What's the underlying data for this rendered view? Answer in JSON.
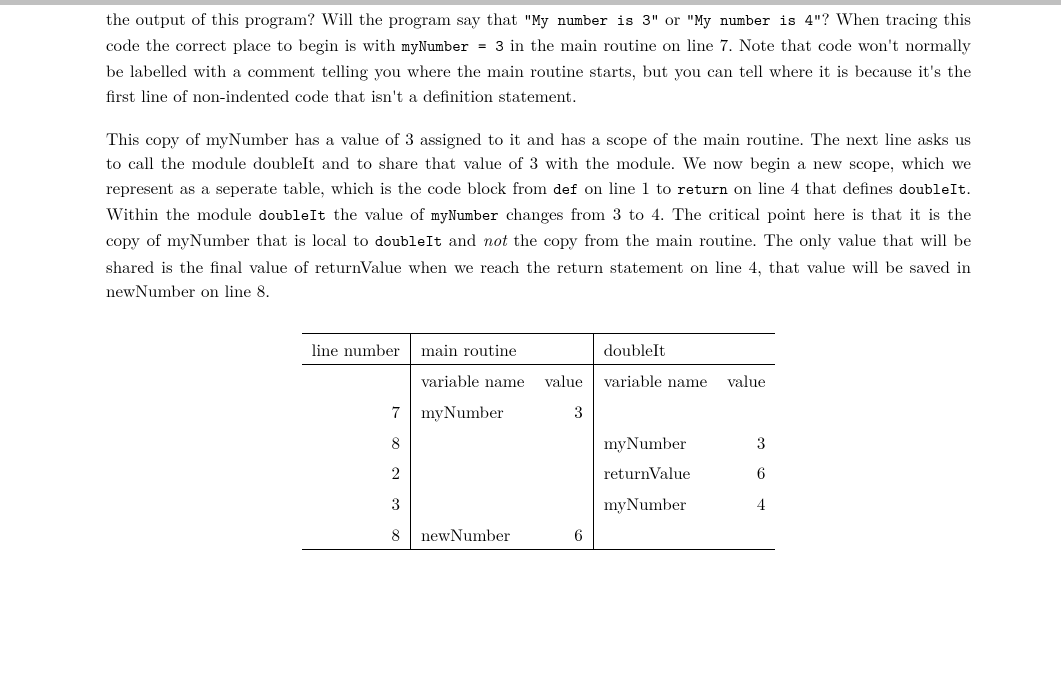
{
  "para1_a": "the output of this program? Will the program say that ",
  "para1_b": "\"My number is 3\"",
  "para1_c": " or ",
  "para1_d": "\"My number is 4\"",
  "para1_e": "? When tracing this code the correct place to begin is with ",
  "para1_f": "myNumber = 3",
  "para1_g": " in the main routine on line 7. Note that code won't normally be labelled with a comment telling you where the main routine starts, but you can tell where it is because it's the first line of non-indented code that isn't a definition statement.",
  "para2_a": "This copy of myNumber has a value of 3 assigned to it and has a scope of the main routine. The next line asks us to call the module doubleIt and to share that value of 3 with the module. We now begin a new scope, which we represent as a seperate table, which is the code block from ",
  "para2_b": "def",
  "para2_c": " on line 1 to ",
  "para2_d": "return",
  "para2_e": " on line 4 that defines ",
  "para2_f": "doubleIt",
  "para2_g": ". Within the module ",
  "para2_h": "doubleIt",
  "para2_i": " the value of ",
  "para2_j": "myNumber",
  "para2_k": " changes from 3 to 4. The critical point here is that it is the copy of myNumber that is local to ",
  "para2_l": "doubleIt",
  "para2_m": " and ",
  "para2_n": "not",
  "para2_o": " the copy from the main routine. The only value that will be shared is the final value of returnValue when we reach the return statement on line 4, that value will be saved in newNumber on line 8.",
  "table": {
    "head": {
      "line_number": "line number",
      "main_routine": "main routine",
      "doubleIt": "doubleIt",
      "variable_name": "variable name",
      "value": "value"
    },
    "rows": [
      {
        "line": "7",
        "main_var": "myNumber",
        "main_val": "3",
        "dbl_var": "",
        "dbl_val": ""
      },
      {
        "line": "8",
        "main_var": "",
        "main_val": "",
        "dbl_var": "myNumber",
        "dbl_val": "3"
      },
      {
        "line": "2",
        "main_var": "",
        "main_val": "",
        "dbl_var": "returnValue",
        "dbl_val": "6"
      },
      {
        "line": "3",
        "main_var": "",
        "main_val": "",
        "dbl_var": "myNumber",
        "dbl_val": "4"
      },
      {
        "line": "8",
        "main_var": "newNumber",
        "main_val": "6",
        "dbl_var": "",
        "dbl_val": ""
      }
    ]
  }
}
